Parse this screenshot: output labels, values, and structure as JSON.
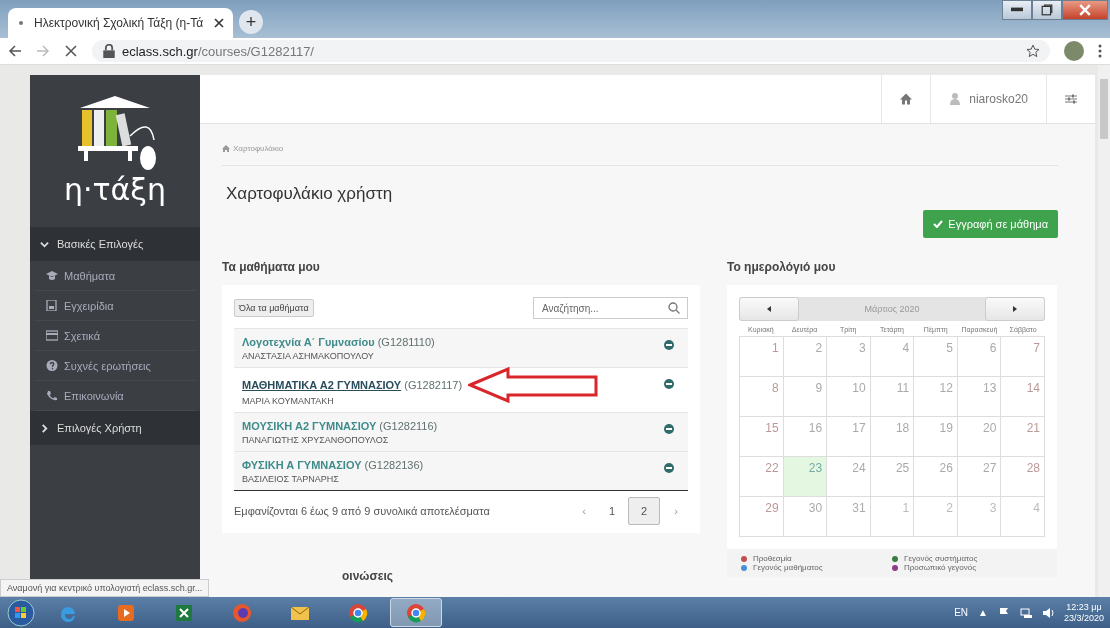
{
  "browser": {
    "tab_title": "Ηλεκτρονική Σχολική Τάξη (η-Τά",
    "tab_loading": true,
    "new_tab": "+",
    "url_host": "eclass.sch.gr",
    "url_path": "/courses/G1282117/"
  },
  "logo_text": "η·τάξη",
  "topbar": {
    "username": "niarosko20"
  },
  "sidebar": {
    "sections": [
      {
        "label": "Βασικές Επιλογές",
        "expanded": true,
        "items": [
          {
            "label": "Μαθήματα"
          },
          {
            "label": "Εγχειρίδια"
          },
          {
            "label": "Σχετικά"
          },
          {
            "label": "Συχνές ερωτήσεις"
          },
          {
            "label": "Επικοινωνία"
          }
        ]
      },
      {
        "label": "Επιλογές Χρήστη",
        "expanded": false
      }
    ]
  },
  "breadcrumb": "Χαρτοφυλάκιο",
  "page_title": "Χαρτοφυλάκιο χρήστη",
  "register_button": "Εγγραφή σε μάθημα",
  "courses": {
    "heading": "Τα μαθήματα μου",
    "all_button": "Όλα τα μαθήματα",
    "search": {
      "placeholder": "Αναζήτηση..."
    },
    "rows": [
      {
        "name": "Λογοτεχνία Α΄ Γυμνασίου",
        "code": "(G1281110)",
        "teacher": "ΑΝΑΣΤΑΣΙΑ ΑΣΗΜΑΚΟΠΟΥΛΟΥ",
        "selected": false
      },
      {
        "name": "ΜΑΘΗΜΑΤΙΚΑ Α2 ΓΥΜΝΑΣΙΟΥ",
        "code": "(G1282117)",
        "teacher": "ΜΑΡΙΑ ΚΟΥΜΑΝΤΑΚΗ",
        "selected": true
      },
      {
        "name": "ΜΟΥΣΙΚΗ Α2 ΓΥΜΝΑΣΙΟΥ",
        "code": "(G1282116)",
        "teacher": "ΠΑΝΑΓΙΩΤΗΣ ΧΡΥΣΑΝΘΟΠΟΥΛΟΣ",
        "selected": false
      },
      {
        "name": "ΦΥΣΙΚΗ Α ΓΥΜΝΑΣΙΟΥ",
        "code": "(G1282136)",
        "teacher": "ΒΑΣΙΛΕΙΟΣ ΤΑΡΝΑΡΗΣ",
        "selected": false
      }
    ],
    "summary": "Εμφανίζονται 6 έως 9 από 9 συνολικά αποτελέσματα",
    "pages": [
      {
        "label": "‹",
        "kind": "arrow",
        "selected": false
      },
      {
        "label": "1",
        "kind": "page",
        "selected": false
      },
      {
        "label": "2",
        "kind": "page",
        "selected": true
      },
      {
        "label": "›",
        "kind": "arrow",
        "selected": false
      }
    ]
  },
  "next_heading": "οινώσεις",
  "calendar": {
    "heading": "Το ημερολόγιό μου",
    "month": "Μάρτιος 2020",
    "weekdays": [
      "Κυριακή",
      "Δευτέρα",
      "Τρίτη",
      "Τετάρτη",
      "Πέμπτη",
      "Παρασκευή",
      "Σάββατο"
    ],
    "weeks": [
      [
        {
          "day": "1",
          "other_month": false,
          "selected": false
        },
        {
          "day": "2",
          "other_month": false,
          "selected": false
        },
        {
          "day": "3",
          "other_month": false,
          "selected": false
        },
        {
          "day": "4",
          "other_month": false,
          "selected": false
        },
        {
          "day": "5",
          "other_month": false,
          "selected": false
        },
        {
          "day": "6",
          "other_month": false,
          "selected": false
        },
        {
          "day": "7",
          "other_month": false,
          "selected": false
        }
      ],
      [
        {
          "day": "8",
          "other_month": false,
          "selected": false
        },
        {
          "day": "9",
          "other_month": false,
          "selected": false
        },
        {
          "day": "10",
          "other_month": false,
          "selected": false
        },
        {
          "day": "11",
          "other_month": false,
          "selected": false
        },
        {
          "day": "12",
          "other_month": false,
          "selected": false
        },
        {
          "day": "13",
          "other_month": false,
          "selected": false
        },
        {
          "day": "14",
          "other_month": false,
          "selected": false
        }
      ],
      [
        {
          "day": "15",
          "other_month": false,
          "selected": false
        },
        {
          "day": "16",
          "other_month": false,
          "selected": false
        },
        {
          "day": "17",
          "other_month": false,
          "selected": false
        },
        {
          "day": "18",
          "other_month": false,
          "selected": false
        },
        {
          "day": "19",
          "other_month": false,
          "selected": false
        },
        {
          "day": "20",
          "other_month": false,
          "selected": false
        },
        {
          "day": "21",
          "other_month": false,
          "selected": false
        }
      ],
      [
        {
          "day": "22",
          "other_month": false,
          "selected": false
        },
        {
          "day": "23",
          "other_month": false,
          "selected": true
        },
        {
          "day": "24",
          "other_month": false,
          "selected": false
        },
        {
          "day": "25",
          "other_month": false,
          "selected": false
        },
        {
          "day": "26",
          "other_month": false,
          "selected": false
        },
        {
          "day": "27",
          "other_month": false,
          "selected": false
        },
        {
          "day": "28",
          "other_month": false,
          "selected": false
        }
      ],
      [
        {
          "day": "29",
          "other_month": false,
          "selected": false
        },
        {
          "day": "30",
          "other_month": false,
          "selected": false
        },
        {
          "day": "31",
          "other_month": false,
          "selected": false
        },
        {
          "day": "1",
          "other_month": true,
          "selected": false
        },
        {
          "day": "2",
          "other_month": true,
          "selected": false
        },
        {
          "day": "3",
          "other_month": true,
          "selected": false
        },
        {
          "day": "4",
          "other_month": true,
          "selected": false
        }
      ]
    ],
    "legend": [
      {
        "label": "Προθεσμία",
        "color": "#c0504d"
      },
      {
        "label": "Γεγονός συστήματος",
        "color": "#3a7d44"
      },
      {
        "label": "Γεγονός μαθήματος",
        "color": "#4a90d9"
      },
      {
        "label": "Προσωπικό γεγονός",
        "color": "#8e3a8e"
      }
    ]
  },
  "status_popup": "Αναμονή για κεντρικό υπολογιστή eclass.sch.gr...",
  "taskbar": {
    "apps": [
      {
        "selected": false
      },
      {
        "selected": false
      },
      {
        "selected": false
      },
      {
        "selected": false
      },
      {
        "selected": false
      },
      {
        "selected": false
      },
      {
        "selected": true
      }
    ],
    "language": "EN",
    "tray_arrow": "▲",
    "time": "12:23 μμ",
    "date": "23/3/2020"
  }
}
